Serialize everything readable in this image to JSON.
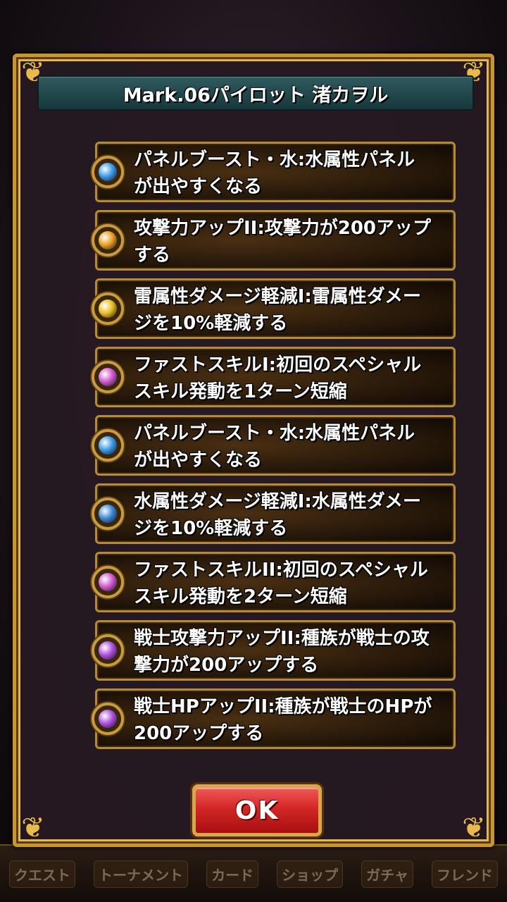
{
  "dialog": {
    "title": "Mark.06パイロット 渚カヲル",
    "ok_label": "OK"
  },
  "skills": [
    {
      "text": "パネルブースト・水:水属性パネル\nが出やすくなる",
      "icon": "water-panel-icon",
      "color": "#3a9ae8"
    },
    {
      "text": "攻撃力アップII:攻撃力が200アップ\nする",
      "icon": "attack-up-icon",
      "color": "#e8a020"
    },
    {
      "text": "雷属性ダメージ軽減I:雷属性ダメー\nジを10%軽減する",
      "icon": "thunder-guard-icon",
      "color": "#e8c020"
    },
    {
      "text": "ファストスキルI:初回のスペシャル\nスキル発動を1ターン短縮",
      "icon": "fast-skill-icon",
      "color": "#d05ad0"
    },
    {
      "text": "パネルブースト・水:水属性パネル\nが出やすくなる",
      "icon": "water-panel-icon",
      "color": "#3a9ae8"
    },
    {
      "text": "水属性ダメージ軽減I:水属性ダメー\nジを10%軽減する",
      "icon": "water-guard-icon",
      "color": "#3a8ad8"
    },
    {
      "text": "ファストスキルII:初回のスペシャル\nスキル発動を2ターン短縮",
      "icon": "fast-skill-icon",
      "color": "#d05ad0"
    },
    {
      "text": "戦士攻撃力アップII:種族が戦士の攻\n撃力が200アップする",
      "icon": "warrior-attack-icon",
      "color": "#b050e0"
    },
    {
      "text": "戦士HPアップII:種族が戦士のHPが\n200アップする",
      "icon": "warrior-hp-icon",
      "color": "#b050e0"
    }
  ],
  "bottom_nav": [
    "クエスト",
    "トーナメント",
    "カード",
    "ショップ",
    "ガチャ",
    "フレンド"
  ]
}
